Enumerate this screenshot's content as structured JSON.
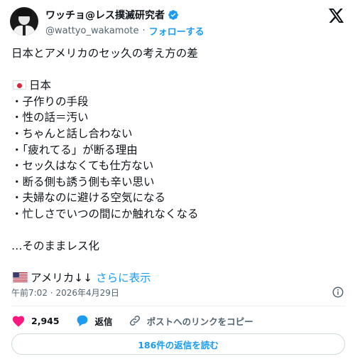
{
  "author": {
    "display_name": "ワッチョ@レス撲滅研究者",
    "handle": "@wattyo_wakamote",
    "separator": "·",
    "follow_label": "フォローする",
    "verified_color": "#1d9bf0"
  },
  "tweet": {
    "lines": [
      "日本とアメリカのセッ久の考え方の差",
      "",
      "日本",
      "・子作りの手段",
      "・性の話＝汚い",
      "・ちゃんと話し合わない",
      "・「疲れてる」が断る理由",
      "・セッ久はなくても仕方ない",
      "・断る側も誘う側も辛い思い",
      "・夫婦なのに避ける空気になる",
      "・忙しさでいつの間にか触れなくなる",
      "",
      "…そのままレス化",
      "",
      "アメリカ↓↓"
    ],
    "show_more_label": "さらに表示"
  },
  "meta": {
    "time": "午前7:02",
    "separator": "·",
    "date": "2026年4月29日"
  },
  "actions": {
    "like_count": "2,945",
    "reply_label": "返信",
    "copy_link_label": "ポストへのリンクをコピー",
    "like_color": "#f91880"
  },
  "read_replies_label": "186件の返信を読む",
  "icons": {
    "brand": "x-logo-icon",
    "verified": "verified-badge-icon",
    "info": "info-icon",
    "like": "heart-icon",
    "reply": "reply-bubble-icon",
    "link": "link-icon",
    "flag_jp": "japan-flag-icon",
    "flag_us": "us-flag-icon"
  }
}
